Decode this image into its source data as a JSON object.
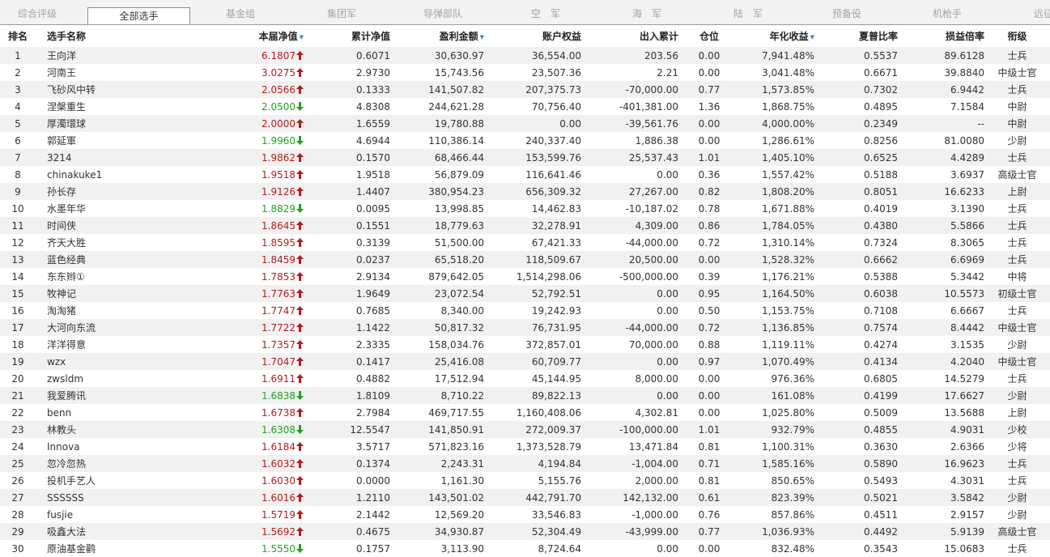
{
  "tabs": [
    {
      "label": "综合评级",
      "active": false
    },
    {
      "label": "全部选手",
      "active": true
    },
    {
      "label": "基金组",
      "active": false
    },
    {
      "label": "集团军",
      "active": false
    },
    {
      "label": "导弹部队",
      "active": false
    },
    {
      "label": "空　军",
      "active": false
    },
    {
      "label": "海　军",
      "active": false
    },
    {
      "label": "陆　军",
      "active": false
    },
    {
      "label": "预备役",
      "active": false
    },
    {
      "label": "机枪手",
      "active": false
    },
    {
      "label": "远征",
      "active": false
    }
  ],
  "headers": [
    "排名",
    "选手名称",
    "本届净值",
    "累计净值",
    "盈利金额",
    "账户权益",
    "出入累计",
    "仓位",
    "年化收益",
    "夏普比率",
    "损益倍率",
    "衔级"
  ],
  "sortable_headers": [
    2,
    4,
    8
  ],
  "colors": {
    "up": "#b21d1d",
    "down": "#1fa31f",
    "sort_arrow": "#3a86c6"
  },
  "rows": [
    [
      "1",
      "王向洋",
      "6.1807",
      "up",
      "0.6071",
      "30,630.97",
      "36,554.00",
      "203.56",
      "0.00",
      "7,941.48%",
      "0.5537",
      "89.6128",
      "士兵"
    ],
    [
      "2",
      "河南王",
      "3.0275",
      "up",
      "2.9730",
      "15,743.56",
      "23,507.36",
      "2.21",
      "0.00",
      "3,041.48%",
      "0.6671",
      "39.8840",
      "中级士官"
    ],
    [
      "3",
      "飞砂风中转",
      "2.0566",
      "up",
      "0.1333",
      "141,507.82",
      "207,375.73",
      "-70,000.00",
      "0.77",
      "1,573.85%",
      "0.7302",
      "6.9442",
      "士兵"
    ],
    [
      "4",
      "涅槃重生",
      "2.0500",
      "down",
      "4.8308",
      "244,621.28",
      "70,756.40",
      "-401,381.00",
      "1.36",
      "1,868.75%",
      "0.4895",
      "7.1584",
      "中尉"
    ],
    [
      "5",
      "厚濁環球",
      "2.0000",
      "up",
      "1.6559",
      "19,780.88",
      "0.00",
      "-39,561.76",
      "0.00",
      "4,000.00%",
      "0.2349",
      "--",
      "中尉"
    ],
    [
      "6",
      "郭延軍",
      "1.9960",
      "down",
      "4.6944",
      "110,386.14",
      "240,337.40",
      "1,886.38",
      "0.00",
      "1,286.61%",
      "0.8256",
      "81.0080",
      "少尉"
    ],
    [
      "7",
      "3214",
      "1.9862",
      "up",
      "0.1570",
      "68,466.44",
      "153,599.76",
      "25,537.43",
      "1.01",
      "1,405.10%",
      "0.6525",
      "4.4289",
      "士兵"
    ],
    [
      "8",
      "chinakuke1",
      "1.9518",
      "up",
      "1.9518",
      "56,879.09",
      "116,641.46",
      "0.00",
      "0.36",
      "1,557.42%",
      "0.5188",
      "3.6937",
      "高级士官"
    ],
    [
      "9",
      "孙长存",
      "1.9126",
      "up",
      "1.4407",
      "380,954.23",
      "656,309.32",
      "27,267.00",
      "0.82",
      "1,808.20%",
      "0.8051",
      "16.6233",
      "上尉"
    ],
    [
      "10",
      "水墨年华",
      "1.8829",
      "down",
      "0.0095",
      "13,998.85",
      "14,462.83",
      "-10,187.02",
      "0.78",
      "1,671.88%",
      "0.4019",
      "3.1390",
      "士兵"
    ],
    [
      "11",
      "时间侠",
      "1.8645",
      "up",
      "0.1551",
      "18,779.63",
      "32,278.91",
      "4,309.00",
      "0.86",
      "1,784.05%",
      "0.4380",
      "5.5866",
      "士兵"
    ],
    [
      "12",
      "齐天大胜",
      "1.8595",
      "up",
      "0.3139",
      "51,500.00",
      "67,421.33",
      "-44,000.00",
      "0.72",
      "1,310.14%",
      "0.7324",
      "8.3065",
      "士兵"
    ],
    [
      "13",
      "蓝色经典",
      "1.8459",
      "up",
      "0.0237",
      "65,518.20",
      "118,509.67",
      "20,500.00",
      "0.00",
      "1,528.32%",
      "0.6662",
      "6.6969",
      "士兵"
    ],
    [
      "14",
      "东东辫①",
      "1.7853",
      "up",
      "2.9134",
      "879,642.05",
      "1,514,298.06",
      "-500,000.00",
      "0.39",
      "1,176.21%",
      "0.5388",
      "5.3442",
      "中将"
    ],
    [
      "15",
      "牧神记",
      "1.7763",
      "up",
      "1.9649",
      "23,072.54",
      "52,792.51",
      "0.00",
      "0.95",
      "1,164.50%",
      "0.6038",
      "10.5573",
      "初级士官"
    ],
    [
      "16",
      "淘淘猪",
      "1.7747",
      "up",
      "0.7685",
      "8,340.00",
      "19,242.93",
      "0.00",
      "0.50",
      "1,153.75%",
      "0.7108",
      "6.6667",
      "士兵"
    ],
    [
      "17",
      "大河向东流",
      "1.7722",
      "up",
      "1.1422",
      "50,817.32",
      "76,731.95",
      "-44,000.00",
      "0.72",
      "1,136.85%",
      "0.7574",
      "8.4442",
      "中级士官"
    ],
    [
      "18",
      "洋洋得意",
      "1.7357",
      "up",
      "2.3335",
      "158,034.76",
      "372,857.01",
      "70,000.00",
      "0.88",
      "1,119.11%",
      "0.4274",
      "3.1535",
      "少尉"
    ],
    [
      "19",
      "wzx",
      "1.7047",
      "up",
      "0.1417",
      "25,416.08",
      "60,709.77",
      "0.00",
      "0.97",
      "1,070.49%",
      "0.4134",
      "4.2040",
      "中级士官"
    ],
    [
      "20",
      "zwsldm",
      "1.6911",
      "up",
      "0.4882",
      "17,512.94",
      "45,144.95",
      "8,000.00",
      "0.00",
      "976.36%",
      "0.6805",
      "14.5279",
      "士兵"
    ],
    [
      "21",
      "我爱腾讯",
      "1.6838",
      "down",
      "1.8109",
      "8,710.22",
      "89,822.13",
      "0.00",
      "0.00",
      "161.08%",
      "0.4199",
      "17.6627",
      "少尉"
    ],
    [
      "22",
      "benn",
      "1.6738",
      "up",
      "2.7984",
      "469,717.55",
      "1,160,408.06",
      "4,302.81",
      "0.00",
      "1,025.80%",
      "0.5009",
      "13.5688",
      "上尉"
    ],
    [
      "23",
      "林教头",
      "1.6308",
      "down",
      "12.5547",
      "141,850.91",
      "272,009.37",
      "-100,000.00",
      "1.01",
      "932.79%",
      "0.4855",
      "4.9031",
      "少校"
    ],
    [
      "24",
      "Innova",
      "1.6184",
      "up",
      "3.5717",
      "571,823.16",
      "1,373,528.79",
      "13,471.84",
      "0.81",
      "1,100.31%",
      "0.3630",
      "2.6366",
      "少将"
    ],
    [
      "25",
      "忽冷忽热",
      "1.6032",
      "up",
      "0.1374",
      "2,243.31",
      "4,194.84",
      "-1,004.00",
      "0.71",
      "1,585.16%",
      "0.5890",
      "16.9623",
      "士兵"
    ],
    [
      "26",
      "投机手艺人",
      "1.6030",
      "up",
      "0.0000",
      "1,161.30",
      "5,155.76",
      "2,000.00",
      "0.81",
      "850.65%",
      "0.5493",
      "4.3031",
      "士兵"
    ],
    [
      "27",
      "SSSSSS",
      "1.6016",
      "up",
      "1.2110",
      "143,501.02",
      "442,791.70",
      "142,132.00",
      "0.61",
      "823.39%",
      "0.5021",
      "3.5842",
      "少尉"
    ],
    [
      "28",
      "fusjie",
      "1.5719",
      "up",
      "2.1442",
      "12,569.20",
      "33,546.83",
      "-1,000.00",
      "0.76",
      "857.86%",
      "0.4511",
      "2.9157",
      "少尉"
    ],
    [
      "29",
      "吸鑫大法",
      "1.5692",
      "up",
      "0.4675",
      "34,930.87",
      "52,304.49",
      "-43,999.00",
      "0.77",
      "1,036.93%",
      "0.4492",
      "5.9139",
      "高级士官"
    ],
    [
      "30",
      "原油基金鹳",
      "1.5550",
      "down",
      "0.1757",
      "3,113.90",
      "8,724.64",
      "0.00",
      "0.00",
      "832.48%",
      "0.3543",
      "15.0683",
      "士兵"
    ]
  ]
}
